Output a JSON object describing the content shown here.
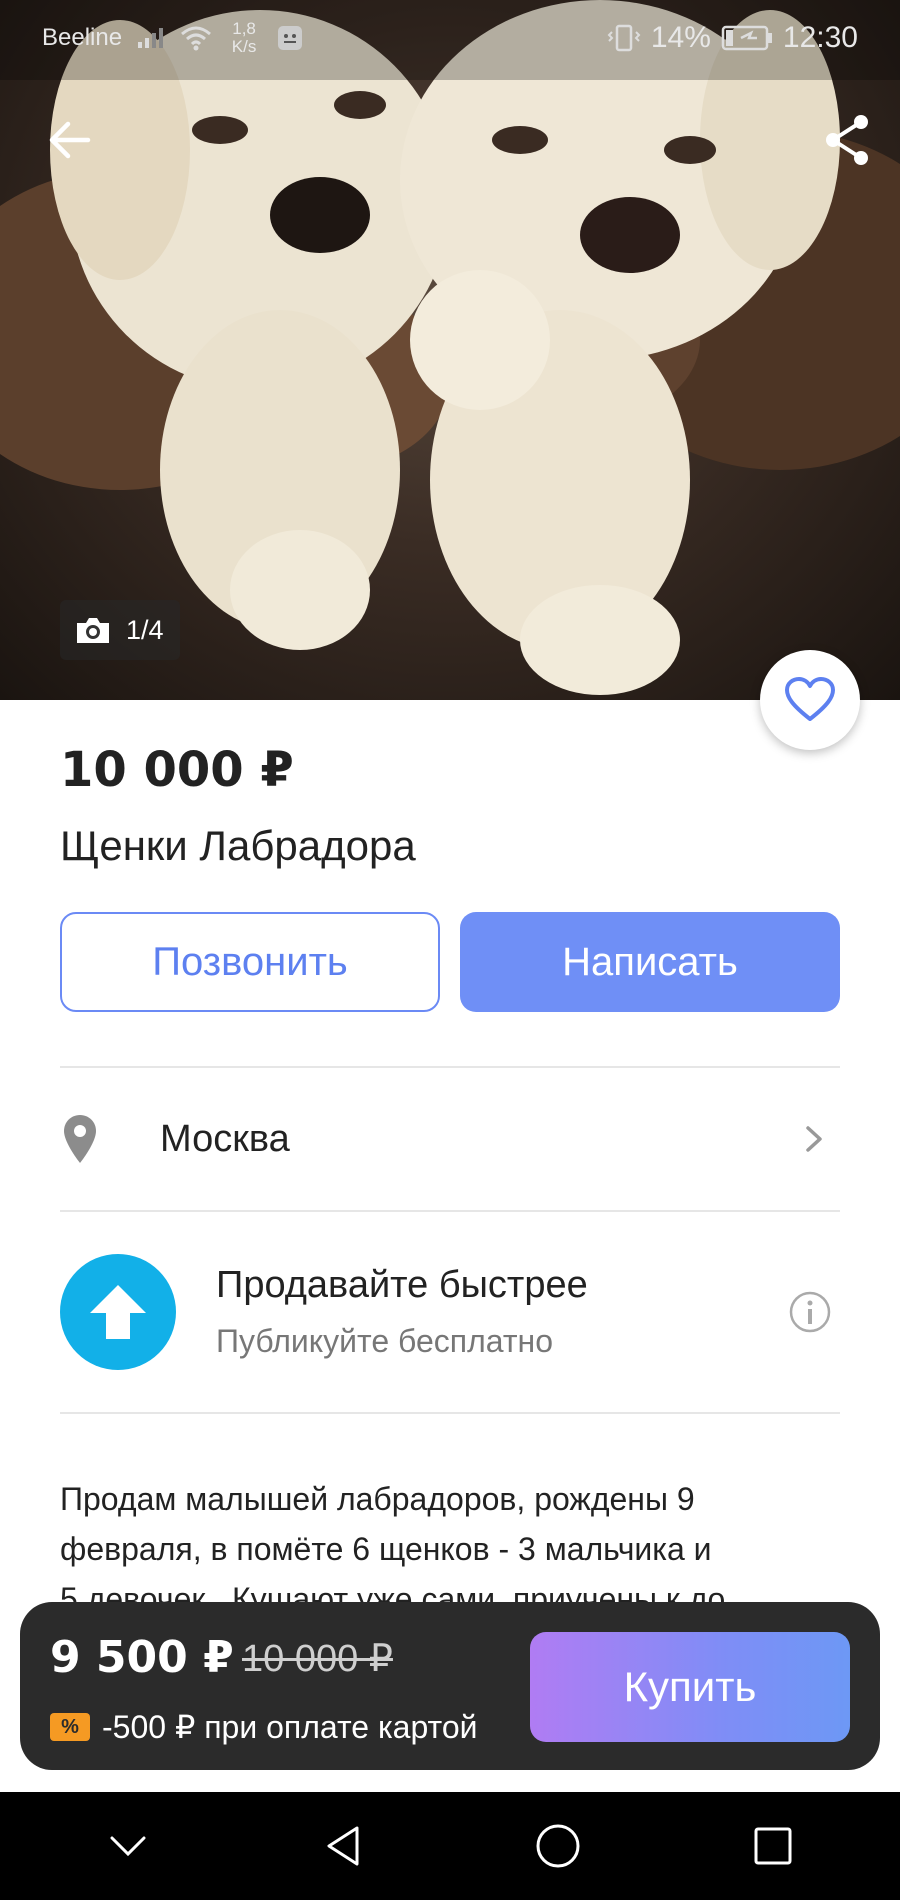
{
  "status_bar": {
    "carrier": "Beeline",
    "net_speed_value": "1,8",
    "net_speed_unit": "K/s",
    "battery": "14%",
    "time": "12:30"
  },
  "gallery": {
    "counter": "1/4"
  },
  "listing": {
    "price": "10 000 ₽",
    "title": "Щенки Лабрадора"
  },
  "actions": {
    "call_label": "Позвонить",
    "message_label": "Написать"
  },
  "location": {
    "city": "Москва"
  },
  "promo": {
    "title": "Продавайте быстрее",
    "subtitle": "Публикуйте бесплатно"
  },
  "description": {
    "line1": "Продам малышей лабрадоров, рождены 9",
    "line2": "февраля, в помёте 6 щенков - 3 мальчика и",
    "line3": "5 девочек . Кушают уже сами, приучены к до..."
  },
  "purchase": {
    "price": "9 500 ₽",
    "old_price": "10 000 ₽",
    "badge": "%",
    "discount_text": "-500 ₽ при оплате картой",
    "buy_label": "Купить"
  },
  "colors": {
    "accent": "#6f8ff6",
    "promo": "#12b0e8",
    "badge": "#f59a23",
    "bar_bg": "#2b2b2b"
  }
}
